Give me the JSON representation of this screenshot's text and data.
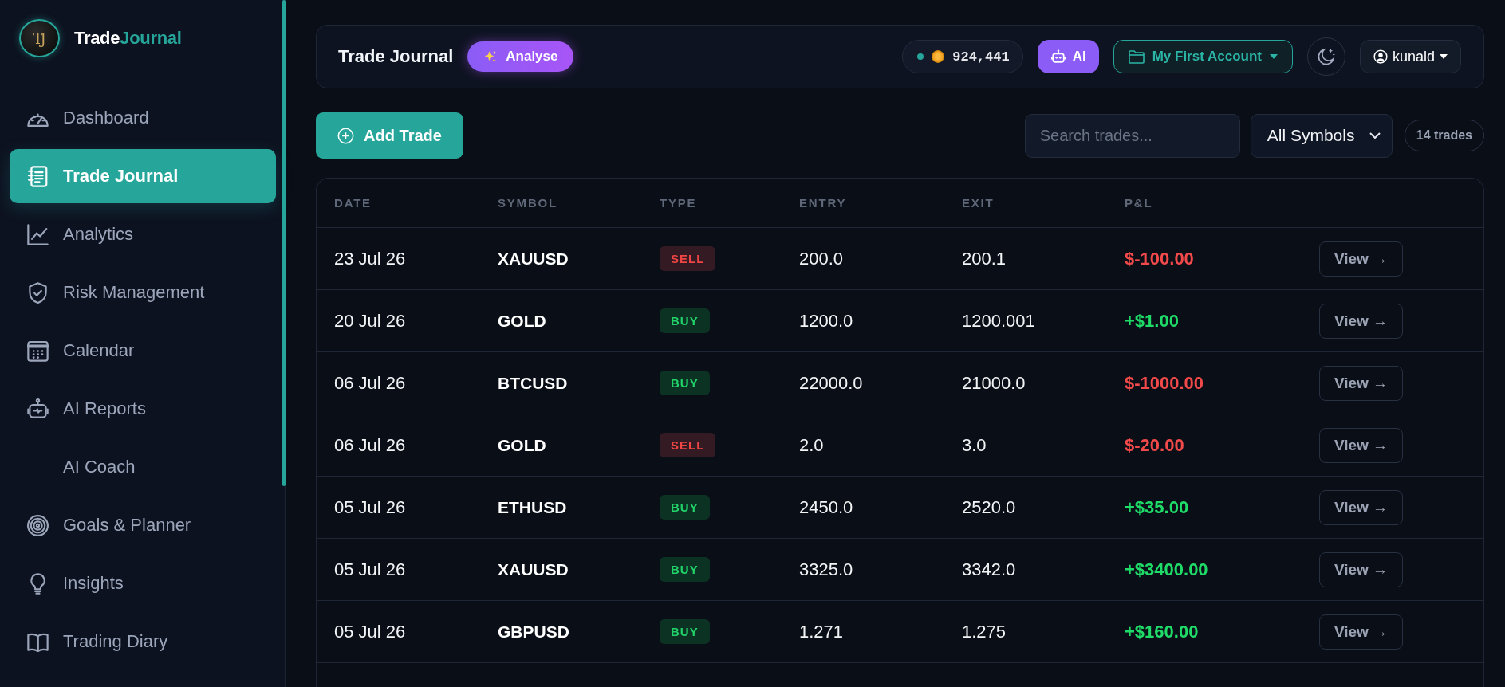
{
  "sidebar": {
    "brand": {
      "monogram": "TJ",
      "words": [
        {
          "text": "Trade",
          "accent": false
        },
        {
          "text": "Journal",
          "accent": true
        }
      ]
    },
    "items": [
      {
        "label": "Dashboard",
        "selected": false
      },
      {
        "label": "Trade Journal",
        "selected": true
      },
      {
        "label": "Analytics",
        "selected": false
      },
      {
        "label": "Risk Management",
        "selected": false
      },
      {
        "label": "Calendar",
        "selected": false
      },
      {
        "label": "AI Reports",
        "selected": false
      },
      {
        "label": "AI Coach",
        "selected": false
      },
      {
        "label": "Goals & Planner",
        "selected": false
      },
      {
        "label": "Insights",
        "selected": false
      },
      {
        "label": "Trading Diary",
        "selected": false
      }
    ]
  },
  "header": {
    "title": "Trade Journal",
    "analyse_button": "Analyse",
    "balance": "924,441",
    "ai_button": "AI",
    "account": "My First Account",
    "user": "kunald"
  },
  "toolbar": {
    "add_button": "Add Trade",
    "search": {
      "placeholder": "Search trades..."
    },
    "symbol_filter": "All Symbols",
    "count": "14 trades"
  },
  "table": {
    "columns": [
      "DATE",
      "SYMBOL",
      "TYPE",
      "ENTRY",
      "EXIT",
      "P&L"
    ],
    "rows": [
      {
        "date": "23 Jul 26",
        "symbol": "XAUUSD",
        "type": {
          "label": "SELL",
          "kind": "sell"
        },
        "entry": "200.0",
        "exit": "200.1",
        "pnl": {
          "text": "$-100.00",
          "kind": "loss"
        },
        "action": "View →"
      },
      {
        "date": "20 Jul 26",
        "symbol": "GOLD",
        "type": {
          "label": "BUY",
          "kind": "buy"
        },
        "entry": "1200.0",
        "exit": "1200.001",
        "pnl": {
          "text": "+$1.00",
          "kind": "gain"
        },
        "action": "View →"
      },
      {
        "date": "06 Jul 26",
        "symbol": "BTCUSD",
        "type": {
          "label": "BUY",
          "kind": "buy"
        },
        "entry": "22000.0",
        "exit": "21000.0",
        "pnl": {
          "text": "$-1000.00",
          "kind": "loss"
        },
        "action": "View →"
      },
      {
        "date": "06 Jul 26",
        "symbol": "GOLD",
        "type": {
          "label": "SELL",
          "kind": "sell"
        },
        "entry": "2.0",
        "exit": "3.0",
        "pnl": {
          "text": "$-20.00",
          "kind": "loss"
        },
        "action": "View →"
      },
      {
        "date": "05 Jul 26",
        "symbol": "ETHUSD",
        "type": {
          "label": "BUY",
          "kind": "buy"
        },
        "entry": "2450.0",
        "exit": "2520.0",
        "pnl": {
          "text": "+$35.00",
          "kind": "gain"
        },
        "action": "View →"
      },
      {
        "date": "05 Jul 26",
        "symbol": "XAUUSD",
        "type": {
          "label": "BUY",
          "kind": "buy"
        },
        "entry": "3325.0",
        "exit": "3342.0",
        "pnl": {
          "text": "+$3400.00",
          "kind": "gain"
        },
        "action": "View →"
      },
      {
        "date": "05 Jul 26",
        "symbol": "GBPUSD",
        "type": {
          "label": "BUY",
          "kind": "buy"
        },
        "entry": "1.271",
        "exit": "1.275",
        "pnl": {
          "text": "+$160.00",
          "kind": "gain"
        },
        "action": "View →"
      }
    ]
  }
}
